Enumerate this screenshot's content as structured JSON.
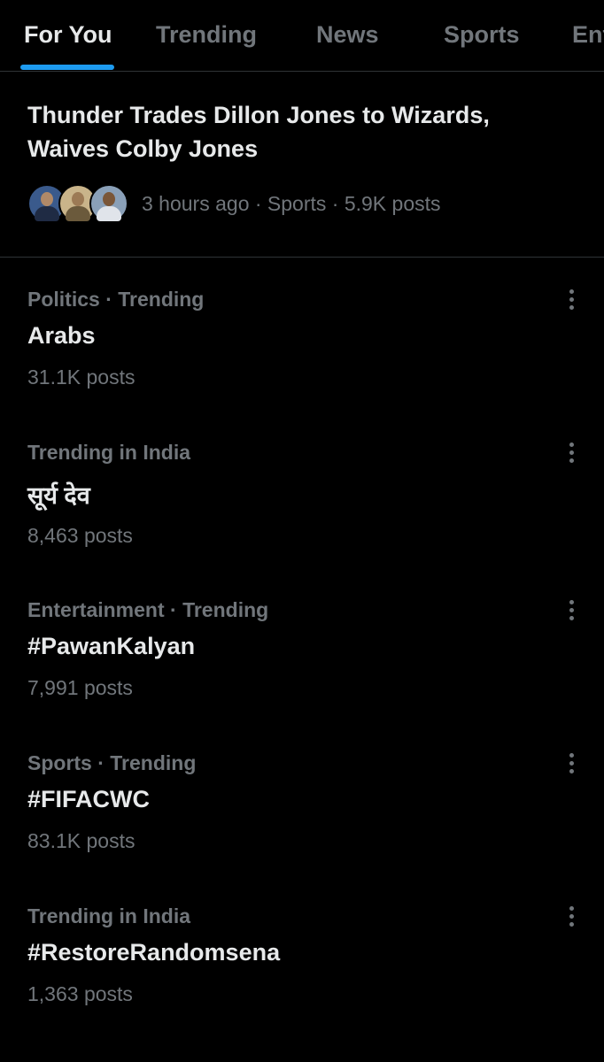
{
  "tabs": [
    {
      "label": "For You",
      "active": true
    },
    {
      "label": "Trending",
      "active": false
    },
    {
      "label": "News",
      "active": false
    },
    {
      "label": "Sports",
      "active": false
    },
    {
      "label": "Ent",
      "active": false
    }
  ],
  "news": {
    "title": "Thunder Trades Dillon Jones to Wizards, Waives Colby Jones",
    "meta": "3 hours ago · Sports · 5.9K posts",
    "avatars": [
      "avatar-1",
      "avatar-2",
      "avatar-3"
    ]
  },
  "trends": [
    {
      "context": "Politics · Trending",
      "name": "Arabs",
      "count": "31.1K posts"
    },
    {
      "context": "Trending in India",
      "name": "सूर्य देव",
      "count": "8,463 posts"
    },
    {
      "context": "Entertainment · Trending",
      "name": "#PawanKalyan",
      "count": "7,991 posts"
    },
    {
      "context": "Sports · Trending",
      "name": "#FIFACWC",
      "count": "83.1K posts"
    },
    {
      "context": "Trending in India",
      "name": "#RestoreRandomsena",
      "count": "1,363 posts"
    }
  ],
  "colors": {
    "background": "#000000",
    "primary_text": "#e7e9ea",
    "secondary_text": "#71767b",
    "accent": "#1d9bf0",
    "divider": "#2f3336"
  },
  "icons": {
    "more": "more-vertical-icon"
  }
}
